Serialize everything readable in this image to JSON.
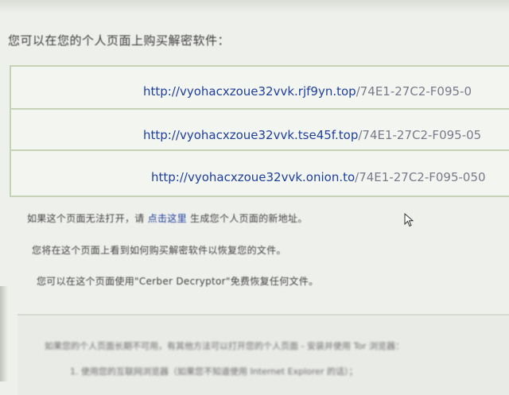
{
  "intro_text": "您可以在您的个人页面上购买解密软件：",
  "links": [
    {
      "host": "http://vyohacxzoue32vvk.rjf9yn.top",
      "path": "/74E1-27C2-F095-0"
    },
    {
      "host": "http://vyohacxzoue32vvk.tse45f.top",
      "path": "/74E1-27C2-F095-05"
    },
    {
      "host": "http://vyohacxzoue32vvk.onion.to",
      "path": "/74E1-27C2-F095-050"
    }
  ],
  "info": {
    "line1_before": "如果这个页面无法打开，请 ",
    "line1_link": "点击这里",
    "line1_after": " 生成您个人页面的新地址。",
    "line2": "您将在这个页面上看到如何购买解密软件以恢复您的文件。",
    "line3": "您可以在这个页面使用\"Cerber Decryptor\"免费恢复任何文件。"
  },
  "bottom": {
    "line1": "如果您的个人页面长期不可用，有其他方法可以打开您的个人页面 - 安装并使用 Tor 浏览器：",
    "line2": "1.  使用您的互联网浏览器（如果您不知道使用 Internet Explorer 的话）；"
  }
}
